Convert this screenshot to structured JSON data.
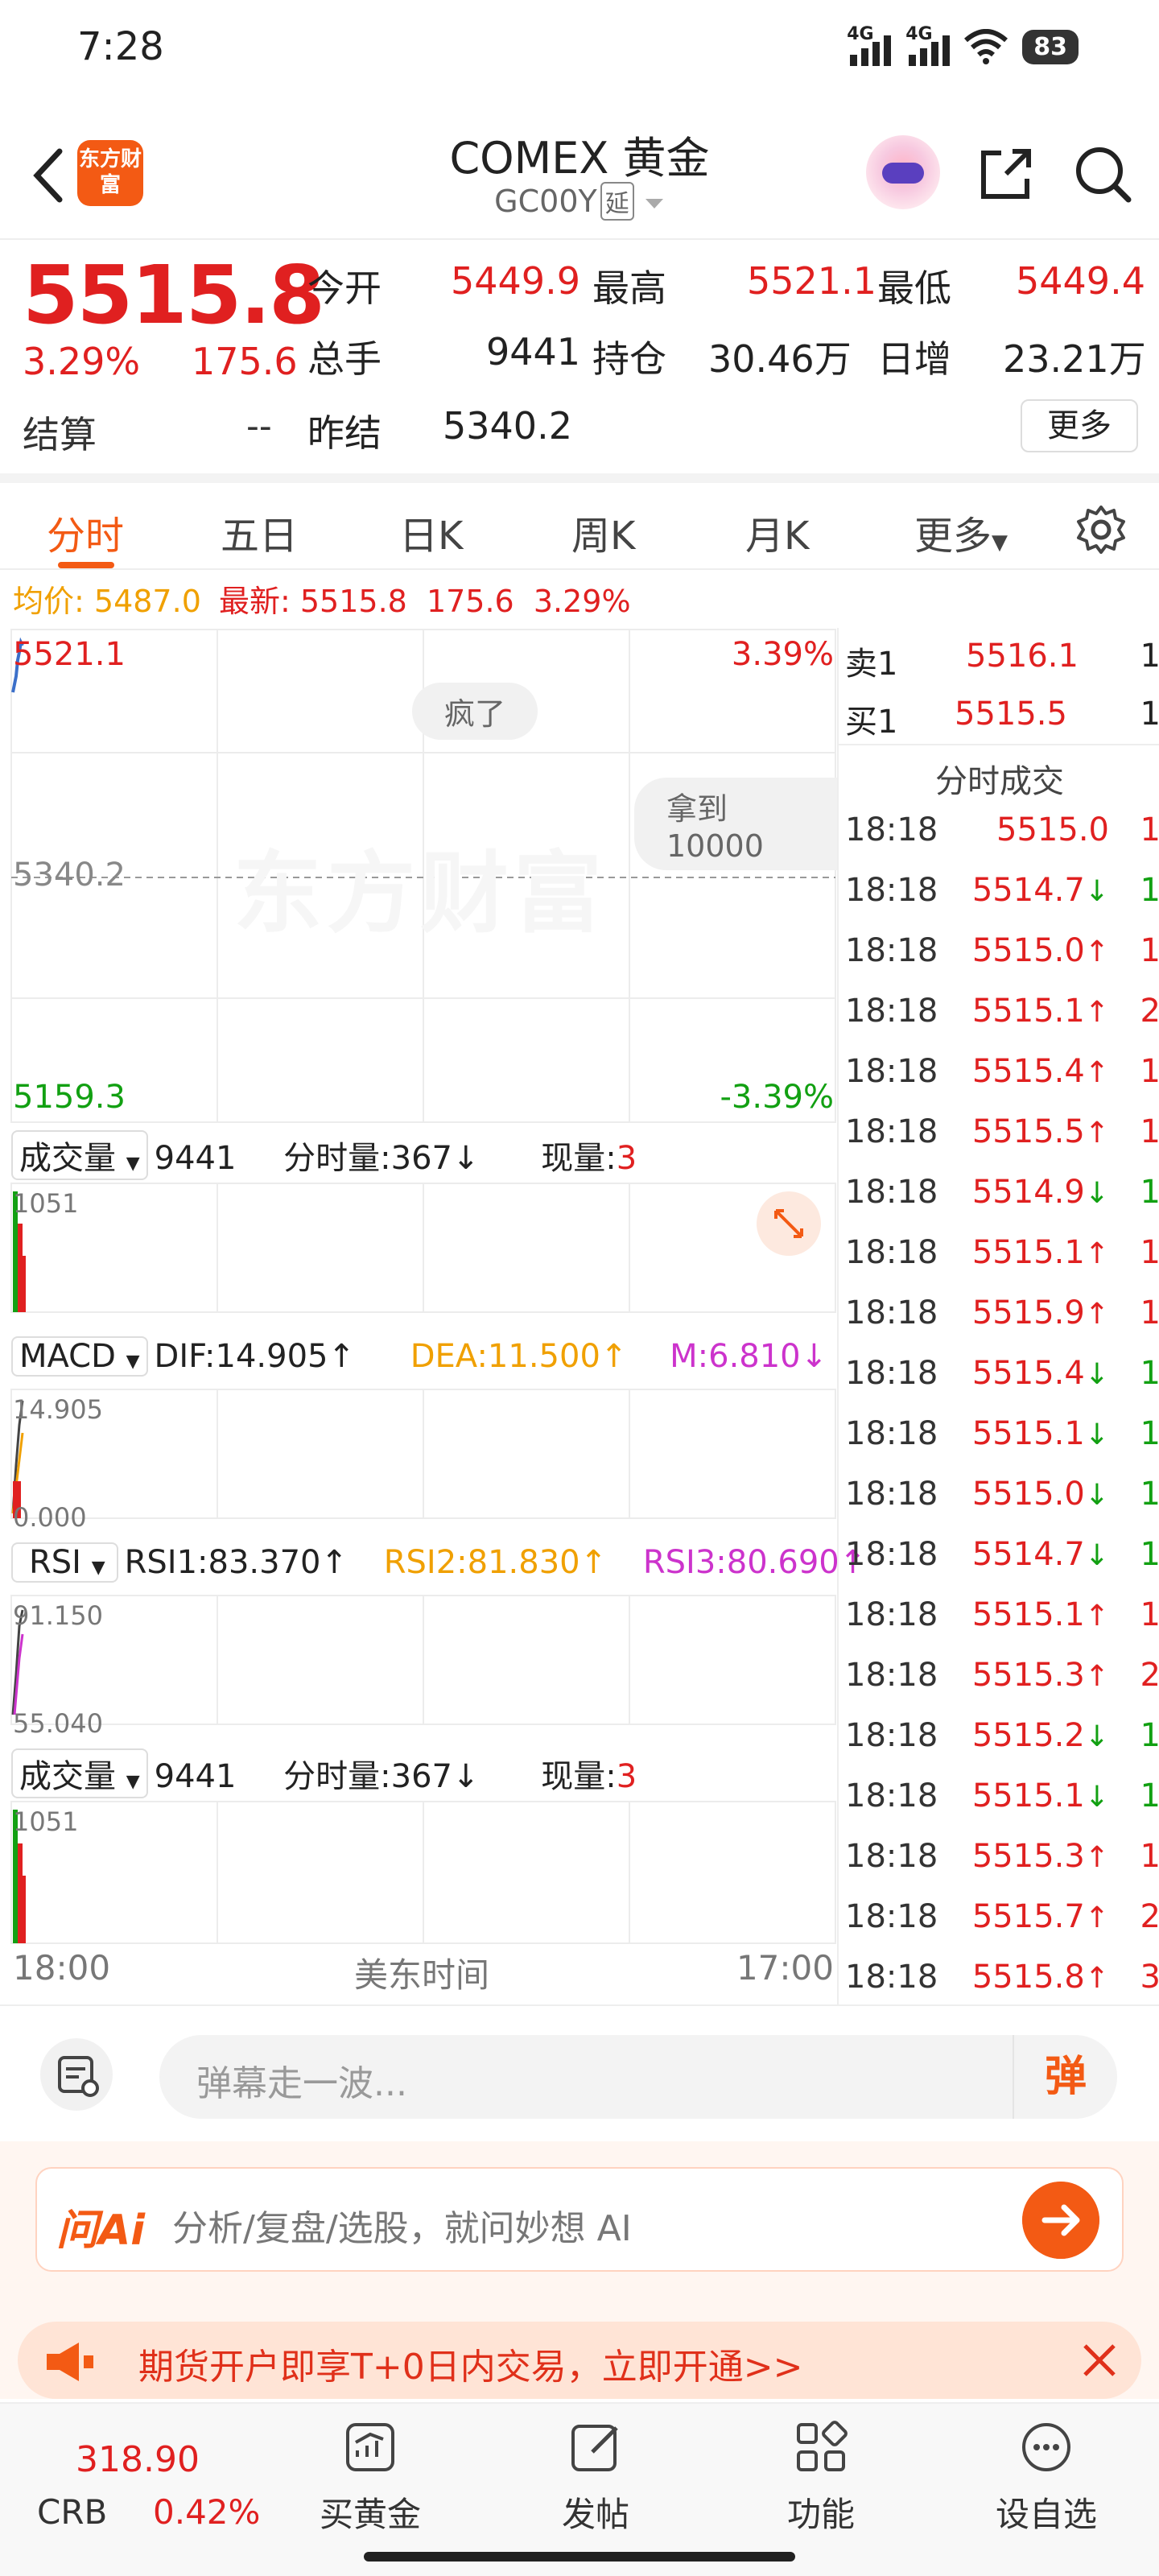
{
  "status": {
    "time": "7:28",
    "sig1": "4G",
    "sig2": "4G",
    "battery": "83"
  },
  "header": {
    "title": "COMEX 黄金",
    "code": "GC00Y",
    "tag": "延",
    "logo": "东方财富"
  },
  "quote": {
    "price": "5515.8",
    "pct": "3.29%",
    "change": "175.6",
    "settle_label": "结算",
    "settle_value": "--",
    "open_label": "今开",
    "open": "5449.9",
    "high_label": "最高",
    "high": "5521.1",
    "low_label": "最低",
    "low": "5449.4",
    "vol_label": "总手",
    "vol": "9441",
    "oi_label": "持仓",
    "oi": "30.46万",
    "inc_label": "日增",
    "inc": "23.21万",
    "prev_label": "昨结",
    "prev": "5340.2",
    "more": "更多"
  },
  "tabs": [
    "分时",
    "五日",
    "日K",
    "周K",
    "月K",
    "更多"
  ],
  "avgline": {
    "avg_label": "均价:",
    "avg": "5487.0",
    "last_label": "最新:",
    "last": "5515.8",
    "chg": "175.6",
    "pct": "3.29%"
  },
  "chart": {
    "top_price": "5521.1",
    "top_pct": "3.39%",
    "mid_price": "5340.2",
    "bot_price": "5159.3",
    "bot_pct": "-3.39%",
    "pill1": "疯了",
    "pill2": "拿到10000",
    "watermark": "东方财富",
    "vol": {
      "name": "成交量",
      "total": "9441",
      "minute": "分时量:367↓",
      "now_label": "现量:",
      "now": "3",
      "max": "1051"
    },
    "macd": {
      "name": "MACD",
      "dif": "DIF:14.905↑",
      "dea": "DEA:11.500↑",
      "m": "M:6.810↓",
      "max": "14.905",
      "min": "0.000"
    },
    "rsi": {
      "name": "RSI",
      "r1": "RSI1:83.370↑",
      "r2": "RSI2:81.830↑",
      "r3": "RSI3:80.690↑",
      "max": "91.150",
      "min": "55.040"
    },
    "vol2": {
      "name": "成交量",
      "total": "9441",
      "minute": "分时量:367↓",
      "now_label": "现量:",
      "now": "3",
      "max": "1051"
    },
    "x_start": "18:00",
    "x_mid": "美东时间",
    "x_end": "17:00"
  },
  "orderbook": {
    "sell_label": "卖1",
    "sell_price": "5516.1",
    "sell_qty": "1",
    "buy_label": "买1",
    "buy_price": "5515.5",
    "buy_qty": "1",
    "trades_title": "分时成交"
  },
  "trades": [
    {
      "t": "18:18",
      "p": "5515.0",
      "d": "",
      "v": "1",
      "c": "red"
    },
    {
      "t": "18:18",
      "p": "5514.7",
      "d": "↓",
      "v": "1",
      "c": "green"
    },
    {
      "t": "18:18",
      "p": "5515.0",
      "d": "↑",
      "v": "1",
      "c": "red"
    },
    {
      "t": "18:18",
      "p": "5515.1",
      "d": "↑",
      "v": "2",
      "c": "red"
    },
    {
      "t": "18:18",
      "p": "5515.4",
      "d": "↑",
      "v": "1",
      "c": "red"
    },
    {
      "t": "18:18",
      "p": "5515.5",
      "d": "↑",
      "v": "1",
      "c": "red"
    },
    {
      "t": "18:18",
      "p": "5514.9",
      "d": "↓",
      "v": "1",
      "c": "green"
    },
    {
      "t": "18:18",
      "p": "5515.1",
      "d": "↑",
      "v": "1",
      "c": "red"
    },
    {
      "t": "18:18",
      "p": "5515.9",
      "d": "↑",
      "v": "1",
      "c": "red"
    },
    {
      "t": "18:18",
      "p": "5515.4",
      "d": "↓",
      "v": "1",
      "c": "green"
    },
    {
      "t": "18:18",
      "p": "5515.1",
      "d": "↓",
      "v": "1",
      "c": "green"
    },
    {
      "t": "18:18",
      "p": "5515.0",
      "d": "↓",
      "v": "1",
      "c": "green"
    },
    {
      "t": "18:18",
      "p": "5514.7",
      "d": "↓",
      "v": "1",
      "c": "green"
    },
    {
      "t": "18:18",
      "p": "5515.1",
      "d": "↑",
      "v": "1",
      "c": "red"
    },
    {
      "t": "18:18",
      "p": "5515.3",
      "d": "↑",
      "v": "2",
      "c": "red"
    },
    {
      "t": "18:18",
      "p": "5515.2",
      "d": "↓",
      "v": "1",
      "c": "green"
    },
    {
      "t": "18:18",
      "p": "5515.1",
      "d": "↓",
      "v": "1",
      "c": "green"
    },
    {
      "t": "18:18",
      "p": "5515.3",
      "d": "↑",
      "v": "1",
      "c": "red"
    },
    {
      "t": "18:18",
      "p": "5515.7",
      "d": "↑",
      "v": "2",
      "c": "red"
    },
    {
      "t": "18:18",
      "p": "5515.8",
      "d": "↑",
      "v": "3",
      "c": "red"
    }
  ],
  "comment": {
    "placeholder": "弹幕走一波...",
    "danmu": "弹"
  },
  "ai": {
    "logo": "问Ai",
    "text": "分析/复盘/选股，就问妙想 AI"
  },
  "promo": {
    "text": "期货开户即享T+0日内交易，立即开通>>"
  },
  "bottom": {
    "crb_value": "318.90",
    "crb_name": "CRB",
    "crb_pct": "0.42%",
    "items": [
      "买黄金",
      "发帖",
      "功能",
      "设自选"
    ]
  },
  "colors": {
    "up": "#e02020",
    "down": "#12a012",
    "accent": "#f35a14",
    "avg": "#f0a000"
  }
}
